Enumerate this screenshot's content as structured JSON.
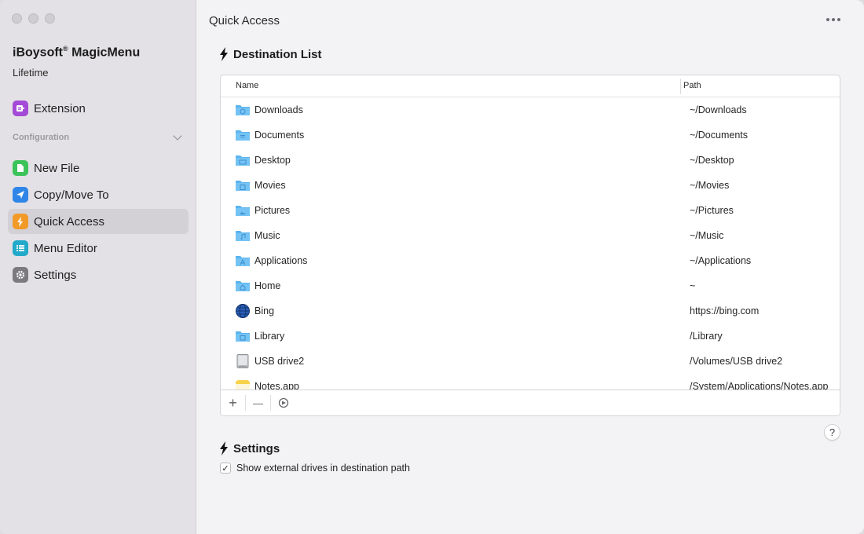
{
  "app": {
    "name": "iBoysoft",
    "name_suffix": "MagicMenu",
    "registered_mark": "®",
    "plan": "Lifetime"
  },
  "sidebar": {
    "extension_label": "Extension",
    "config_header": "Configuration",
    "items": [
      {
        "label": "New File",
        "icon": "new-file-icon",
        "color": "#3cc45a"
      },
      {
        "label": "Copy/Move To",
        "icon": "copy-move-icon",
        "color": "#2f86e8"
      },
      {
        "label": "Quick Access",
        "icon": "bolt-icon",
        "color": "#f29a28"
      },
      {
        "label": "Menu Editor",
        "icon": "menu-editor-icon",
        "color": "#23a9c9"
      },
      {
        "label": "Settings",
        "icon": "gear-icon",
        "color": "#7b7a80"
      }
    ],
    "active_index": 2
  },
  "main": {
    "title": "Quick Access",
    "destination_heading": "Destination List",
    "settings_heading": "Settings"
  },
  "table": {
    "col_name": "Name",
    "col_path": "Path",
    "rows": [
      {
        "name": "Downloads",
        "path": "~/Downloads",
        "icon": "folder-downloads"
      },
      {
        "name": "Documents",
        "path": "~/Documents",
        "icon": "folder-documents"
      },
      {
        "name": "Desktop",
        "path": "~/Desktop",
        "icon": "folder-desktop"
      },
      {
        "name": "Movies",
        "path": "~/Movies",
        "icon": "folder-movies"
      },
      {
        "name": "Pictures",
        "path": "~/Pictures",
        "icon": "folder-pictures"
      },
      {
        "name": "Music",
        "path": "~/Music",
        "icon": "folder-music"
      },
      {
        "name": "Applications",
        "path": "~/Applications",
        "icon": "folder-applications"
      },
      {
        "name": "Home",
        "path": "~",
        "icon": "folder-home"
      },
      {
        "name": "Bing",
        "path": "https://bing.com",
        "icon": "globe"
      },
      {
        "name": "Library",
        "path": "/Library",
        "icon": "folder-library"
      },
      {
        "name": "USB drive2",
        "path": "/Volumes/USB drive2",
        "icon": "drive"
      },
      {
        "name": "Notes.app",
        "path": "/System/Applications/Notes.app",
        "icon": "notes-app"
      }
    ]
  },
  "toolbar": {
    "add_label": "+",
    "remove_label": "—"
  },
  "settings": {
    "show_external_label": "Show external drives in destination path",
    "show_external_checked": true,
    "help_label": "?"
  }
}
